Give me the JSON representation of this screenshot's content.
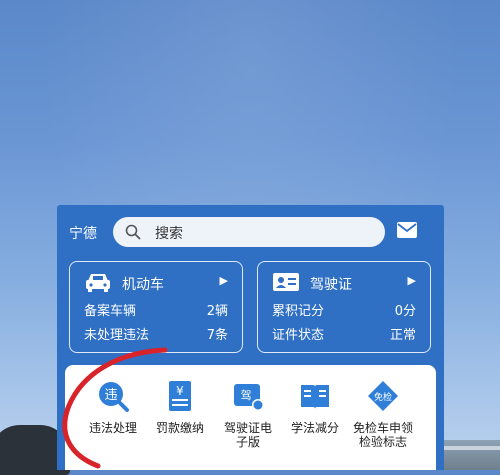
{
  "header": {
    "city": "宁德",
    "search_placeholder": "搜索",
    "search_icon": "search-icon",
    "mail_icon": "mail-icon"
  },
  "vehicle_card": {
    "title": "机动车",
    "icon": "car-icon",
    "rows": [
      {
        "label": "备案车辆",
        "value": "2辆"
      },
      {
        "label": "未处理违法",
        "value": "7条"
      }
    ]
  },
  "license_card": {
    "title": "驾驶证",
    "icon": "id-card-icon",
    "rows": [
      {
        "label": "累积记分",
        "value": "0分"
      },
      {
        "label": "证件状态",
        "value": "正常"
      }
    ]
  },
  "services": [
    {
      "label": "违法处理",
      "icon": "violation-icon",
      "icon_text": "违"
    },
    {
      "label": "罚款缴纳",
      "icon": "fine-payment-icon",
      "icon_text": "¥"
    },
    {
      "label": "驾驶证电子版",
      "line1": "驾驶证电",
      "line2": "子版",
      "icon": "e-license-icon",
      "icon_text": "驾"
    },
    {
      "label": "学法减分",
      "icon": "book-icon"
    },
    {
      "label": "免检车申领检验标志",
      "line1": "免检车申领",
      "line2": "检验标志",
      "icon": "inspection-exempt-icon",
      "icon_text": "免检"
    }
  ],
  "colors": {
    "header_blue": "#2f6fc4",
    "annotation_red": "#d8232a",
    "icon_blue": "#2f7fd9"
  }
}
